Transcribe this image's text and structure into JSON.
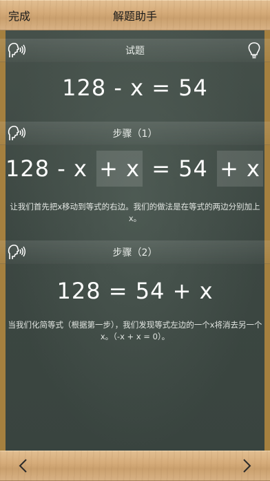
{
  "header": {
    "done_label": "完成",
    "title": "解题助手"
  },
  "problem": {
    "heading": "试题",
    "equation": [
      "128",
      "-",
      "x",
      "=",
      "54"
    ]
  },
  "steps": [
    {
      "heading": "步骤（1）",
      "left": [
        "128",
        "-",
        "x"
      ],
      "left_added": [
        "+",
        "x"
      ],
      "right": [
        "=",
        "54"
      ],
      "right_added": [
        "+",
        "x"
      ],
      "explanation": "让我们首先把x移动到等式的右边。我们的做法是在等式的两边分别加上x。"
    },
    {
      "heading": "步骤（2）",
      "equation": [
        "128",
        "=",
        "54",
        "+",
        "x"
      ],
      "explanation": "当我们化简等式（根据第一步），我们发现等式左边的一个x将消去另一个x。（-x + x = 0）。"
    }
  ],
  "icons": {
    "speak": "speaker-head-icon",
    "hint": "lightbulb-icon",
    "prev": "chevron-left-icon",
    "next": "chevron-right-icon"
  },
  "colors": {
    "wood": "#d6ac7a",
    "board": "#3f4a44",
    "chalk": "#ffffff"
  }
}
